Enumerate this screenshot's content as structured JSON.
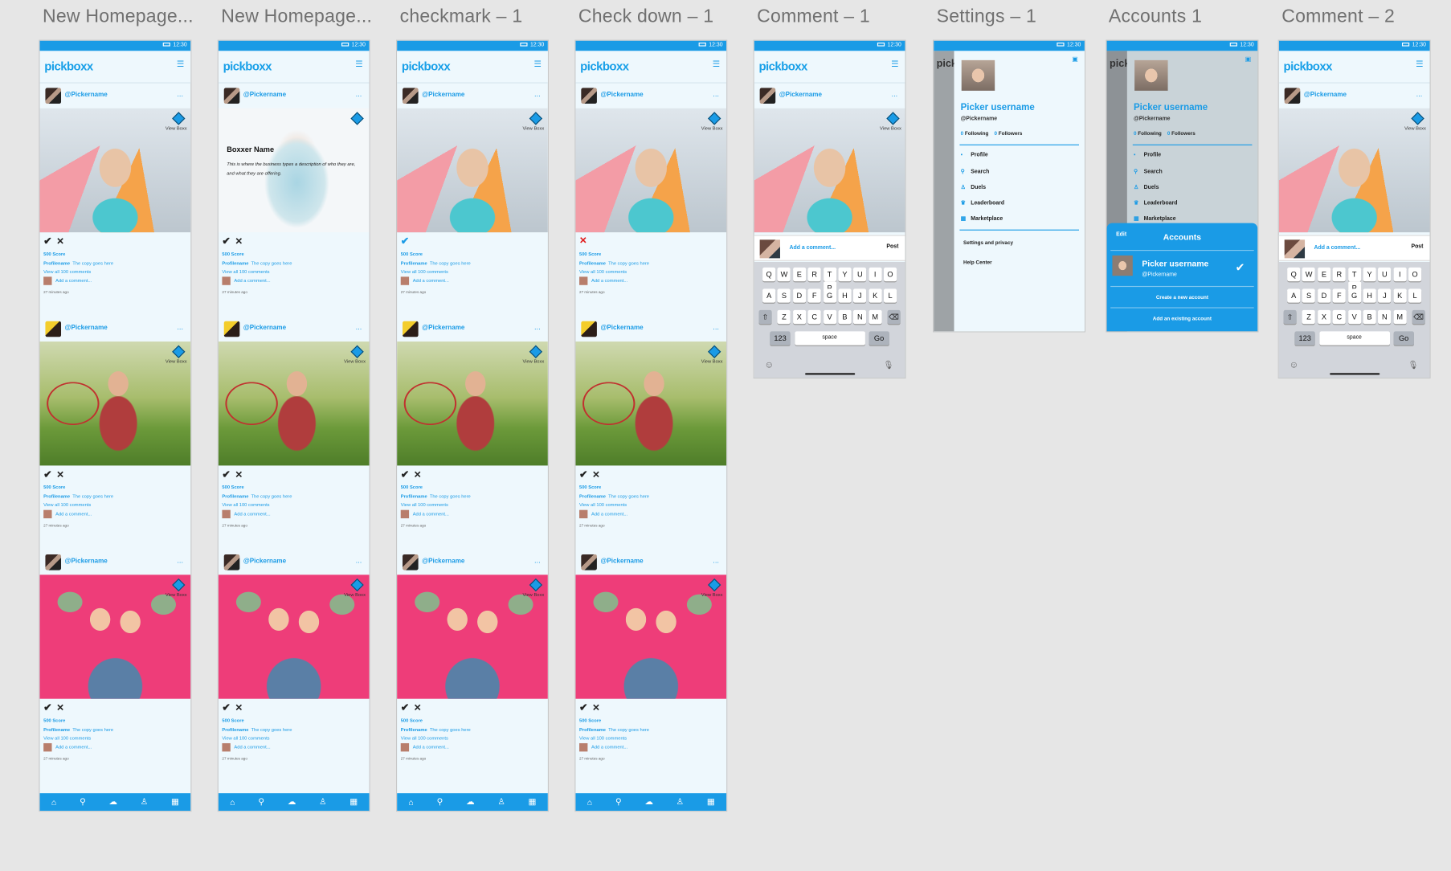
{
  "artboards": [
    {
      "label": "New Homepage..."
    },
    {
      "label": "New Homepage..."
    },
    {
      "label": "checkmark – 1"
    },
    {
      "label": "Check down – 1"
    },
    {
      "label": "Comment – 1"
    },
    {
      "label": "Settings – 1"
    },
    {
      "label": "Accounts 1"
    },
    {
      "label": "Comment – 2"
    }
  ],
  "status": {
    "time": "12:30"
  },
  "app": {
    "logo_a": "pick",
    "logo_b": "boxx"
  },
  "post": {
    "username": "@Pickername",
    "more": "...",
    "view_boxx": "View Boxx",
    "score": "500 Score",
    "profile_name": "Profilename",
    "caption": "The copy goes here",
    "view_comments": "View all 100 comments",
    "add_comment": "Add a comment...",
    "time_ago": "27 minutes ago",
    "check": "✔",
    "cross": "✕"
  },
  "boxxer": {
    "name": "Boxxer Name",
    "description": "This is where the business types a description of who they are, and what they are offering."
  },
  "comment_bar": {
    "placeholder": "Add a comment...",
    "post": "Post"
  },
  "keyboard": {
    "row1": [
      "Q",
      "W",
      "E",
      "R",
      "T",
      "Y",
      "U",
      "I",
      "O",
      "P"
    ],
    "row2": [
      "A",
      "S",
      "D",
      "F",
      "G",
      "H",
      "J",
      "K",
      "L"
    ],
    "row3": [
      "Z",
      "X",
      "C",
      "V",
      "B",
      "N",
      "M"
    ],
    "num": "123",
    "space": "space",
    "go": "Go"
  },
  "drawer": {
    "username": "Picker username",
    "handle": "@Pickername",
    "following_count": "0",
    "following_label": "Following",
    "followers_count": "0",
    "followers_label": "Followers",
    "items": [
      "Profile",
      "Search",
      "Duels",
      "Leaderboard",
      "Marketplace"
    ],
    "settings": "Settings and privacy",
    "help": "Help Center"
  },
  "accounts": {
    "edit": "Edit",
    "title": "Accounts",
    "username": "Picker username",
    "handle": "@Pickername",
    "create": "Create a new account",
    "add_existing": "Add an existing account"
  },
  "colors": {
    "accent": "#1a9be6",
    "pink": "#ee3d79",
    "background": "#e6e6e6"
  }
}
